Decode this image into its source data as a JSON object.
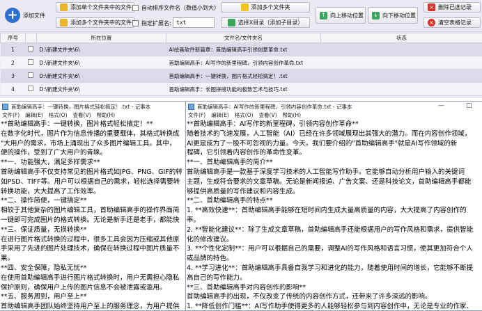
{
  "toolbar": {
    "add_file": "添加文件",
    "add_single_folder": "添加单个文件夹中的文件",
    "add_multi_folder": "添加多个文件夹中的文件",
    "auto_sort": "自动排序文件名（数值小到大）",
    "specify_ext": "指定扩展名:",
    "ext_value": "txt",
    "add_multi_folders": "添加多个文件夹",
    "select_dir": "选择X目录（添加子目录）",
    "move_up": "向上移动位置",
    "move_down": "向下移动位置",
    "delete_selected": "删除已选记录",
    "clear_table": "清空表格记录"
  },
  "table": {
    "headers": [
      "序号",
      "",
      "所在位置",
      "文件名/文件夹名",
      "状态"
    ],
    "rows": [
      {
        "num": "1",
        "path": "D:\\新建文件夹\\6\\",
        "name": "AI绘画软件新篇章：首助编辑高手引领创意革命.txt",
        "status": ""
      },
      {
        "num": "2",
        "path": "D:\\新建文件夹\\6\\",
        "name": "首助编辑高手：AI写作的新里程碑，引领内容创作革命.txt",
        "status": ""
      },
      {
        "num": "3",
        "path": "D:\\新建文件夹\\6\\",
        "name": "首助编辑高手：一键转换，图片格式轻松搞定！.txt",
        "status": ""
      },
      {
        "num": "4",
        "path": "D:\\新建文件夹\\6\\",
        "name": "首助编辑高手：长图拼接功能的极致艺术与技巧.txt",
        "status": ""
      }
    ]
  },
  "notepad_left": {
    "title": "首助编辑高手：一键转换，图片格式轻松搞定！.txt - 记事本",
    "menu": [
      "文件(F)",
      "编辑(E)",
      "格式(O)",
      "查看(V)",
      "帮助(H)"
    ],
    "lines": [
      "**首助编辑高手：一键转换，图片格式轻松搞定！**",
      "在数字化时代，图片作为信息传播的重要载体，其格式转换成",
      "\"大用户的需求，市场上涌现出了众多图片编辑工具。其中，",
      "便的操作，受到了广大用户的青睐。",
      "**一、功能强大，满足多样需求**",
      "首助编辑高手不仅支持常见的图片格式如JPG、PNG、GIF的转",
      "如PSD、TIFF等。用户可以根据自己的需求，轻松选择需要转",
      "转换功能，大大提高了工作效率。",
      "**二、操作简便，一键搞定**",
      "相较于其他复杂的图片编辑工具，首助编辑高手的操作界面简",
      "一键即可完成图片的格式转换。无论是新手还是老手，都能快",
      "**三、保证质量，无损转换**",
      "在进行图片格式转换的过程中，很多工具会因为压缩或其他原",
      "手采用了先进的图片处理技术，确保在转换过程中图片质量不",
      "果。",
      "**四、安全保障，隐私无忧**",
      "在使用首助编辑高手进行图片格式转换时，用户无需担心隐私",
      "保护原则，确保用户上传的图片信息不会被泄露或滥用。",
      "**五、服务周到，用户至上**",
      "首助编辑高手团队始终坚持用户至上的服务理念，为用户提供"
    ]
  },
  "notepad_right": {
    "title": "首助编辑高手：AI写作的新里程碑，引领内容创作革命.txt - 记事本",
    "menu": [
      "文件(F)",
      "编辑(E)",
      "格式(O)",
      "查看(V)",
      "帮助(H)"
    ],
    "controls": [
      "—",
      "□"
    ],
    "lines": [
      "**首助编辑高手：AI写作的新里程碑，引领内容创作革命**",
      "随着技术的飞速发展，人工智能（AI）已经在许多领域展现出其强大的潜力。而在内容创作领域，",
      "AI更是成为了一股不可忽视的力量。今天，我们要介绍的\"首助编辑高手\"就是AI写作领域的新",
      "程碑，它引领着内容创作的革命性变革。",
      "**一、首助编辑高手的简介**",
      "首助编辑高手是一款基于深度学习技术的人工智能写作助手。它能够自动分析用户输入的关键词",
      "主题，生成符合要求的文章草稿。无论是新闻报道、广告文案、还是科技论文，首助编辑高手都能",
      "够提供高质量的写作建议和内容生成。",
      "**二、首助编辑高手的特点**",
      "1. **高效快速**：首助编辑高手能够在短时间内生成大量高质量的内容，大大提高了内容创作的",
      "率。",
      "2. **智能化建议**：除了生成文章草稿，首助编辑高手还能根据用户的写作风格和需求，提供智能",
      "化的修改建议。",
      "3. **个性化定制**：用户可以根据自己的需要，调整AI的写作风格和语言习惯，使其更加符合个人",
      "或品牌的特色。",
      "4. **学习进化**：首助编辑高手具备自我学习和进化的能力，随着使用时间的增长，它能够不断提",
      "高自己的写作能力。",
      "**三、首助编辑高手对内容创作的影响**",
      "首助编辑高手的出现，不仅改变了传统的内容创作方式，还带来了许多深远的影响。",
      "1. **降低创作门槛**：AI写作助手使得更多的人能够轻松参与到内容创作中，无论是专业的作家、"
    ]
  },
  "colors": {
    "accent": "#2f6fd0",
    "row_alt": "#ddd9ea",
    "danger": "#d9342b"
  }
}
